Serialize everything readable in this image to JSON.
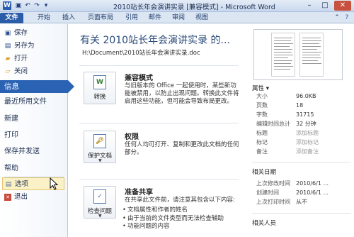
{
  "window": {
    "title": "2010站长年会演讲实录 [兼容模式] - Microsoft Word",
    "app_icon": "W",
    "minimize": "–",
    "maximize": "□",
    "close": "✕"
  },
  "tabs": [
    "文件",
    "开始",
    "插入",
    "页面布局",
    "引用",
    "邮件",
    "审阅",
    "视图"
  ],
  "nav": {
    "save": "保存",
    "save_as": "另存为",
    "open": "打开",
    "close": "关闭",
    "info": "信息",
    "recent": "最近所用文件",
    "new": "新建",
    "print": "打印",
    "save_send": "保存并发送",
    "help": "帮助",
    "options": "选项",
    "exit": "退出"
  },
  "main": {
    "doc_title": "有关 2010站长年会演讲实录 的...",
    "doc_path": "H:\\Document\\2010站长年会演讲实录.doc",
    "compat": {
      "button": "转换",
      "heading": "兼容模式",
      "text": "与旧版本的 Office 一起使用时，某些新功能被禁用，以防止出现问题。转换此文件将启用这些功能，但可能会导致布局更改。"
    },
    "perm": {
      "button": "保护文档",
      "heading": "权限",
      "text": "任何人均可打开、复制和更改此文档的任何部分。"
    },
    "share": {
      "button": "检查问题",
      "heading": "准备共享",
      "text": "在共享此文件前，请注意其包含以下内容:",
      "bullets": [
        "文档属性和作者的姓名",
        "由于当前的文件类型而无法检查辅助",
        "功能问题的内容"
      ]
    }
  },
  "props": {
    "title": "属性 ▾",
    "rows": [
      {
        "k": "大小",
        "v": "96.0KB"
      },
      {
        "k": "页数",
        "v": "18"
      },
      {
        "k": "字数",
        "v": "31715"
      },
      {
        "k": "编辑时间总计",
        "v": "32 分钟"
      },
      {
        "k": "标题",
        "v": "添加标题"
      },
      {
        "k": "标记",
        "v": "添加标记"
      },
      {
        "k": "备注",
        "v": "添加备注"
      }
    ],
    "dates_title": "相关日期",
    "dates": [
      {
        "k": "上次修改时间",
        "v": "2010/6/1 ..."
      },
      {
        "k": "创建时间",
        "v": "2010/6/1 ..."
      },
      {
        "k": "上次打印时间",
        "v": "从不"
      }
    ],
    "people_title": "相关人员"
  }
}
